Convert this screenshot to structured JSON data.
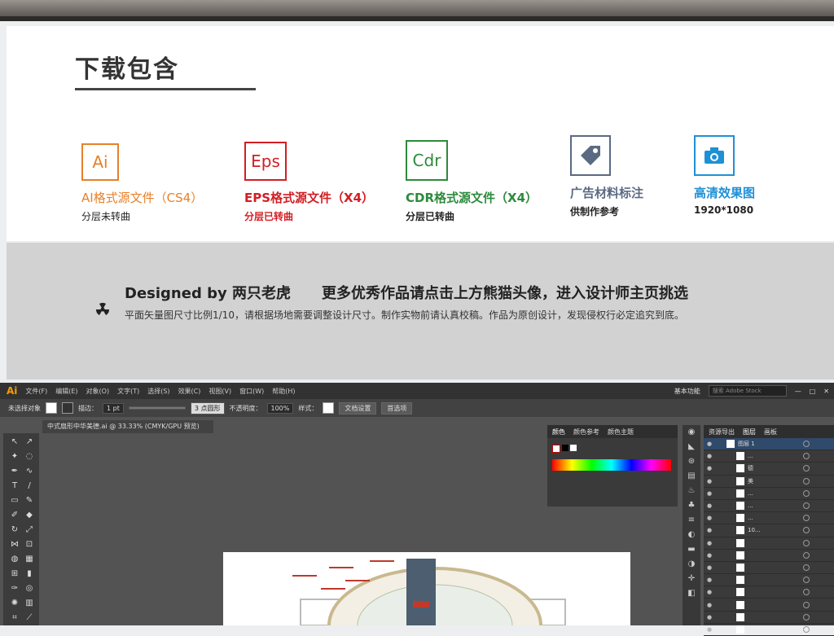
{
  "section": {
    "title": "下载包含"
  },
  "formats": [
    {
      "icon_text": "Ai",
      "name": "AI格式源文件（CS4）",
      "sub": "分层未转曲",
      "color": "#e7802a"
    },
    {
      "icon_text": "Eps",
      "name": "EPS格式源文件（X4）",
      "sub": "分层已转曲",
      "color": "#d21e24"
    },
    {
      "icon_text": "Cdr",
      "name": "CDR格式源文件（X4）",
      "sub": "分层已转曲",
      "color": "#2d8a3c"
    },
    {
      "icon_text": "tag-icon",
      "name": "广告材料标注",
      "sub": "供制作参考",
      "color": "#5a6a82"
    },
    {
      "icon_text": "camera-icon",
      "name": "高清效果图",
      "sub": "1920*1080",
      "color": "#1e90d6"
    }
  ],
  "designer": {
    "credit": "Designed by 两只老虎",
    "tagline": "更多优秀作品请点击上方熊猫头像，进入设计师主页挑选",
    "note": "平面矢量图尺寸比例1/10，请根据场地需要调整设计尺寸。制作实物前请认真校稿。作品为原创设计，发现侵权行必定追究到底。"
  },
  "illustrator": {
    "logo": "Ai",
    "menu": [
      "文件(F)",
      "编辑(E)",
      "对象(O)",
      "文字(T)",
      "选择(S)",
      "效果(C)",
      "视图(V)",
      "窗口(W)",
      "帮助(H)"
    ],
    "workspace": "基本功能",
    "search_placeholder": "搜索 Adobe Stock",
    "control": {
      "selection": "未选择对象",
      "stroke_label": "描边：",
      "stroke_value": "1 pt",
      "brush": "3 点圆形",
      "opacity_label": "不透明度：",
      "opacity_value": "100%",
      "style_label": "样式：",
      "doc_setup": "文档设置",
      "prefs": "首选项"
    },
    "doc_tab": "中式扇形中华美德.ai @ 33.33% (CMYK/GPU 预览)",
    "color_panel": {
      "tabs": [
        "颜色",
        "颜色参考",
        "颜色主题"
      ]
    },
    "layers_panel": {
      "tabs": [
        "资源导出",
        "图层",
        "画板"
      ],
      "rows": [
        "图层 1",
        "...",
        "德",
        "美",
        "...",
        "...",
        "...",
        "10...",
        "",
        "",
        "",
        "",
        "",
        "",
        "",
        ""
      ]
    }
  }
}
